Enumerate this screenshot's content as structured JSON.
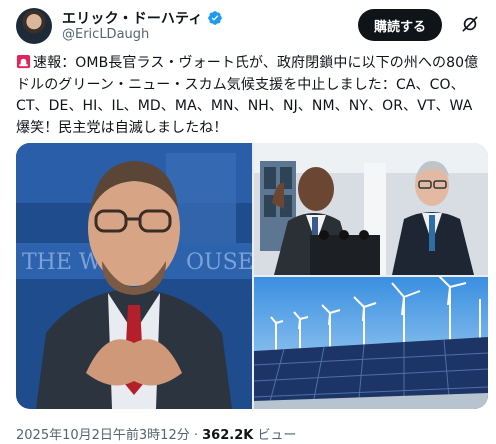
{
  "author": {
    "display_name": "エリック・ドーハティ",
    "handle": "@EricLDaugh"
  },
  "actions": {
    "subscribe_label": "購読する"
  },
  "tweet": {
    "lines": [
      "速報：OMB長官ラス・ヴォート氏が、政府閉鎖中に以下の州への80億",
      "ドルのグリーン・ニュー・スカム気候支援を中止しました：CA、CO、",
      "CT、DE、HI、IL、MD、MA、MN、NH、NJ、NM、NY、OR、VT、WA",
      "爆笑！民主党は自滅しましたね！"
    ]
  },
  "meta": {
    "timestamp": "2025年10月2日午前3時12分",
    "separator": " · ",
    "views": "362.2K",
    "views_label": " ビュー"
  },
  "icons": {
    "verified": "verified-badge-icon",
    "siren": "rotating-light-icon",
    "grok": "grok-icon"
  },
  "colors": {
    "verified": "#1d9bf0",
    "button_bg": "#0f1419",
    "secondary_text": "#536471"
  }
}
